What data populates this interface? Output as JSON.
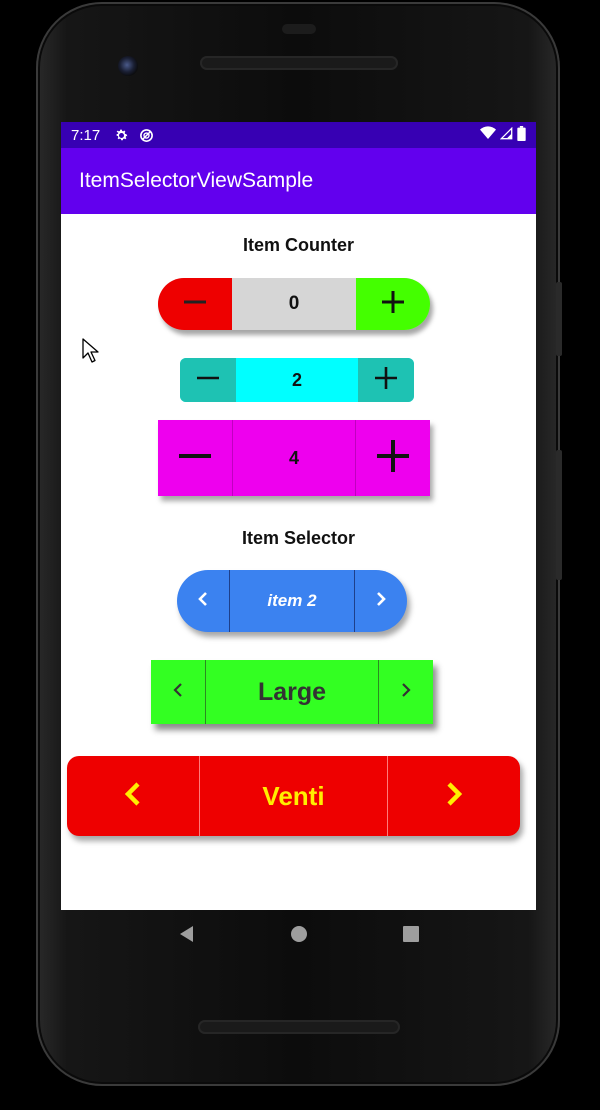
{
  "status_bar": {
    "time": "7:17",
    "icons_left": [
      "gear-icon",
      "no-disturb-icon"
    ],
    "icons_right": [
      "wifi-icon",
      "signal-icon",
      "battery-icon"
    ]
  },
  "app_bar": {
    "title": "ItemSelectorViewSample"
  },
  "counter_section": {
    "title": "Item Counter",
    "counters": [
      {
        "value": "0",
        "minus_color": "#ee0000",
        "plus_color": "#44ff00",
        "center_color": "#d6d6d6"
      },
      {
        "value": "2",
        "button_color": "#1ec2b3",
        "center_color": "#00ffff"
      },
      {
        "value": "4",
        "color": "#ee00ee"
      }
    ]
  },
  "selector_section": {
    "title": "Item Selector",
    "selectors": [
      {
        "value": "item 2",
        "color": "#3b82f0",
        "text_color": "#ffffff"
      },
      {
        "value": "Large",
        "color": "#33ff22",
        "text_color": "#333333"
      },
      {
        "value": "Venti",
        "color": "#ee0000",
        "text_color": "#ffee00"
      }
    ]
  },
  "nav_bar": {
    "icons": [
      "back-icon",
      "home-icon",
      "recents-icon"
    ]
  },
  "colors": {
    "status_bar": "#3700b3",
    "app_bar": "#6200ee"
  }
}
